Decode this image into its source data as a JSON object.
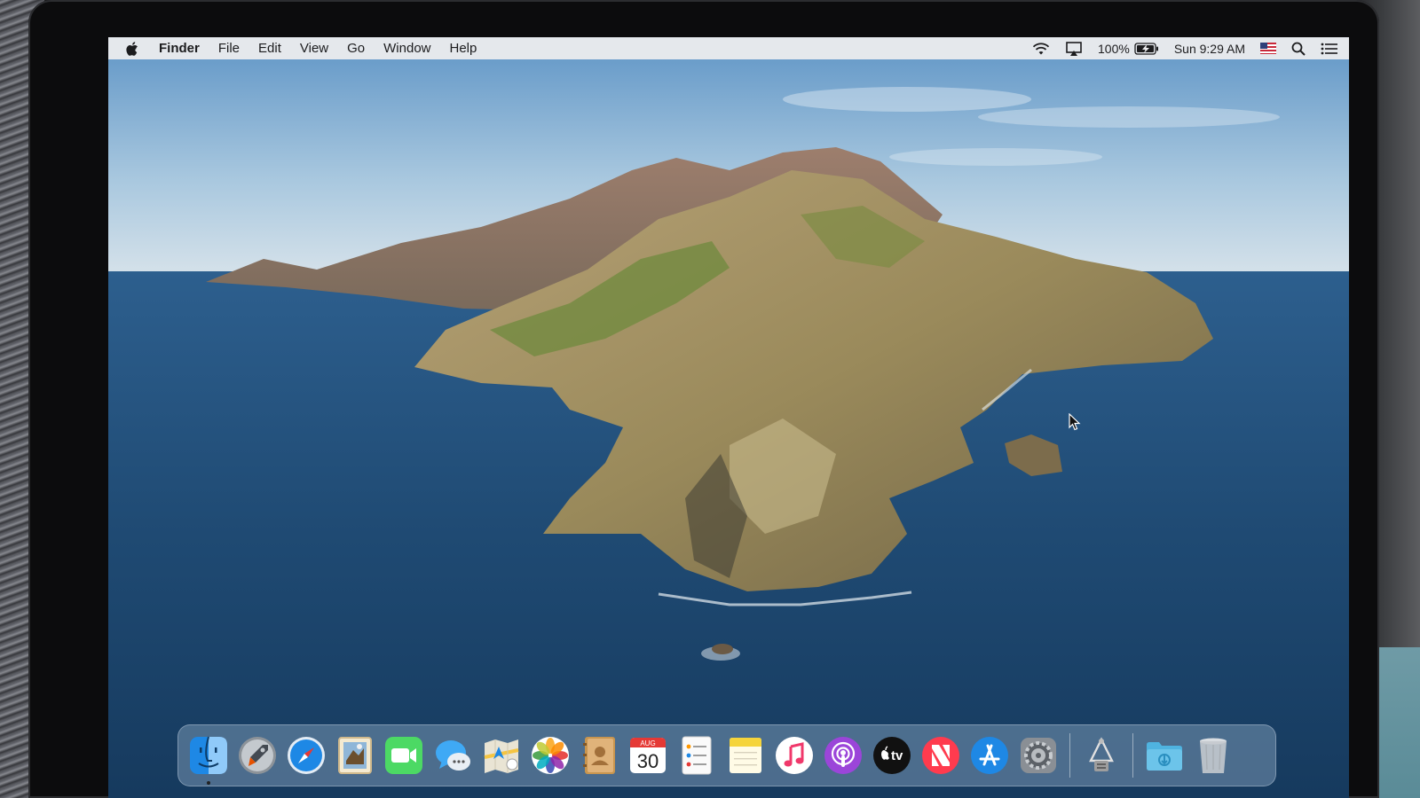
{
  "menubar": {
    "app_name": "Finder",
    "menus": [
      "File",
      "Edit",
      "View",
      "Go",
      "Window",
      "Help"
    ],
    "battery_percent": "100%",
    "clock": "Sun 9:29 AM"
  },
  "dock": {
    "calendar": {
      "month": "AUG",
      "day": "30"
    },
    "tv_label": "tv",
    "items": [
      "finder-icon",
      "launchpad-icon",
      "safari-icon",
      "mail-icon",
      "facetime-icon",
      "messages-icon",
      "maps-icon",
      "photos-icon",
      "contacts-icon",
      "calendar-icon",
      "reminders-icon",
      "notes-icon",
      "music-icon",
      "podcasts-icon",
      "apple-tv-icon",
      "news-icon",
      "app-store-icon",
      "system-preferences-icon",
      "archive-utility-icon",
      "downloads-folder-icon",
      "trash-icon"
    ]
  },
  "colors": {
    "menubar_bg": "#ececee",
    "ocean": "#1f4a73",
    "sky": "#86b3d6",
    "dock_bg": "#7896b2"
  }
}
